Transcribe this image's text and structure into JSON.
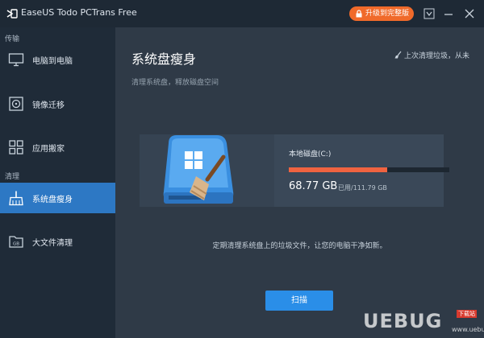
{
  "app": {
    "title": "EaseUS Todo PCTrans Free",
    "upgrade_label": "升级到完整版",
    "accent_color": "#2d78c4",
    "upgrade_color": "#f06a2a"
  },
  "window_controls": {
    "menu_icon": "dropdown-menu-icon",
    "minimize_icon": "minimize-icon",
    "close_icon": "close-icon"
  },
  "sidebar": {
    "section_transfer": "传输",
    "section_clean": "清理",
    "items": [
      {
        "label": "电脑到电脑",
        "icon": "monitor-icon",
        "active": false
      },
      {
        "label": "镜像迁移",
        "icon": "disc-image-icon",
        "active": false
      },
      {
        "label": "应用搬家",
        "icon": "apps-icon",
        "active": false
      },
      {
        "label": "系统盘瘦身",
        "icon": "broom-icon",
        "active": true
      },
      {
        "label": "大文件清理",
        "icon": "large-file-icon",
        "active": false
      }
    ]
  },
  "main": {
    "title": "系统盘瘦身",
    "last_clean": "上次清理垃圾，从未",
    "subtitle": "清理系统盘，释放磁盘空间",
    "hint": "定期清理系统盘上的垃圾文件，让您的电脑干净如新。",
    "scan_label": "扫描"
  },
  "drive": {
    "name": "本地磁盘(C:)",
    "used": "68.77 GB",
    "total": "已用/111.79 GB",
    "used_fraction": 0.615,
    "bar_color": "#f06340"
  },
  "watermark": {
    "text": "UEBUG",
    "badge": "下载站",
    "domain": "www.uebug.com"
  }
}
